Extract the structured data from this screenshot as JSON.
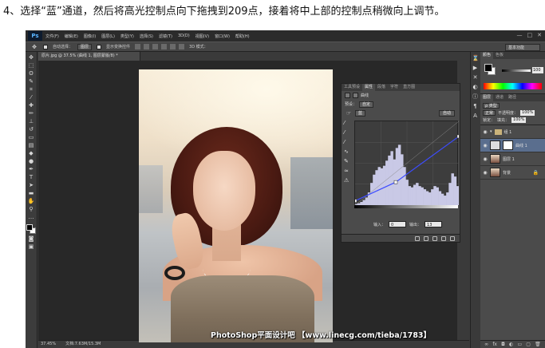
{
  "instruction": "4、选择“蓝”通道，然后将高光控制点向下拖拽到209点，接着将中上部的控制点稍微向上调节。",
  "menubar": {
    "logo": "Ps",
    "items": [
      "文件(F)",
      "编辑(E)",
      "图像(I)",
      "图层(L)",
      "类型(Y)",
      "选择(S)",
      "滤镜(T)",
      "3D(D)",
      "视图(V)",
      "窗口(W)",
      "帮助(H)"
    ],
    "window_controls": [
      "—",
      "□",
      "✕"
    ]
  },
  "options_bar": {
    "auto_select_label": "自动选择：",
    "auto_select_value": "图层",
    "transform_label": "显示变换控件",
    "mode_3d_label": "3D 模式：",
    "workspace": "基本功能"
  },
  "document": {
    "tab_title": "原片.jpg @ 37.5% (曲线 1, 图层蒙版/8) *",
    "zoom": "37.45%",
    "doc_size": "文档:7.63M/15.3M"
  },
  "watermark": "PhotoShop平面设计吧 【www.linecg.com/tieba/1783】",
  "properties_panel": {
    "tabs": [
      "工具预设",
      "属性",
      "段落",
      "字符",
      "直方图"
    ],
    "active_tab": "属性",
    "title": "曲线",
    "preset_label": "预设：",
    "preset_value": "自定",
    "channel_value": "蓝",
    "auto_label": "自动",
    "input_label": "输入：",
    "input_value": "0",
    "output_label": "输出：",
    "output_value": "13"
  },
  "color_panel": {
    "tabs": [
      "颜色",
      "色板"
    ],
    "slider_value": "100"
  },
  "layers_panel": {
    "tabs": [
      "图层",
      "通道",
      "路径"
    ],
    "kind_label": "ρ 类型",
    "blend_mode": "正常",
    "opacity_label": "不透明度：",
    "opacity_value": "100%",
    "lock_label": "锁定：",
    "fill_label": "填充：",
    "fill_value": "100%",
    "layers": [
      {
        "name": "组 1"
      },
      {
        "name": "曲线 1"
      },
      {
        "name": "图层 1"
      },
      {
        "name": "背景"
      }
    ]
  },
  "curves_chart": {
    "channel": "蓝",
    "curve_points": [
      [
        0,
        13
      ],
      [
        100,
        70
      ],
      [
        255,
        209
      ]
    ],
    "histogram": [
      2,
      3,
      5,
      8,
      12,
      20,
      35,
      48,
      55,
      60,
      58,
      62,
      70,
      78,
      85,
      72,
      90,
      95,
      80,
      60,
      40,
      30,
      28,
      32,
      35,
      30,
      28,
      25,
      22,
      20,
      25,
      30,
      28,
      22,
      18,
      15,
      20,
      35,
      50,
      45,
      30
    ]
  },
  "colors": {
    "ui_dark": "#3a3a3a",
    "panel": "#4b4b4b",
    "selected_layer": "#5a6e8e"
  }
}
